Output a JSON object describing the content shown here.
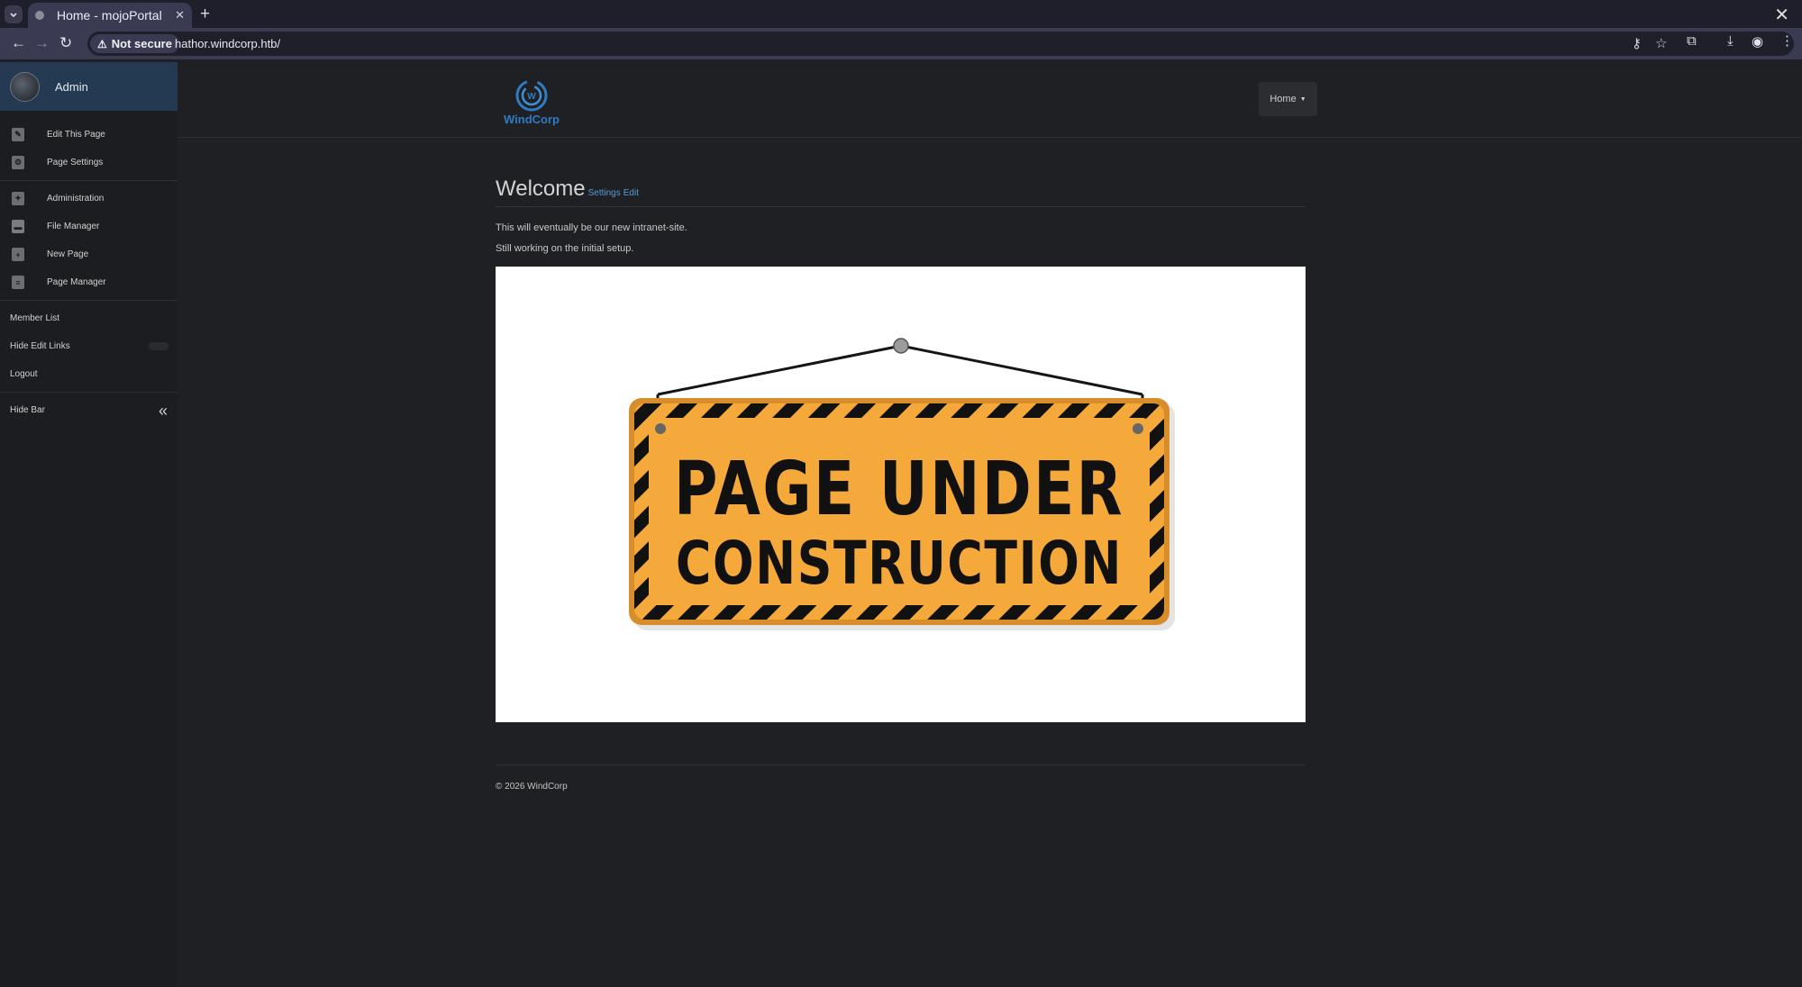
{
  "browser": {
    "tab_title": "Home - mojoPortal",
    "security_label": "Not secure",
    "url": "hathor.windcorp.htb/"
  },
  "sidebar": {
    "user_name": "Admin",
    "edit_page": "Edit This Page",
    "page_settings": "Page Settings",
    "administration": "Administration",
    "file_manager": "File Manager",
    "new_page": "New Page",
    "page_manager": "Page Manager",
    "member_list": "Member List",
    "hide_edit_links": "Hide Edit Links",
    "logout": "Logout",
    "hide_bar": "Hide Bar"
  },
  "header": {
    "logo_text": "WindCorp",
    "logo_letter": "W",
    "menu_label": "Home"
  },
  "main": {
    "title": "Welcome",
    "settings_link": "Settings",
    "edit_link": "Edit",
    "paragraph_1": "This will eventually be our new intranet-site.",
    "paragraph_2": "Still working on the initial setup.",
    "sign_line_1": "PAGE UNDER",
    "sign_line_2": "CONSTRUCTION"
  },
  "footer": {
    "copyright": "© 2026 WindCorp"
  },
  "colors": {
    "sign_fill": "#f5a93b",
    "sign_stripe": "#111111",
    "accent_link": "#5a9bd6",
    "admin_header": "#243a52"
  }
}
